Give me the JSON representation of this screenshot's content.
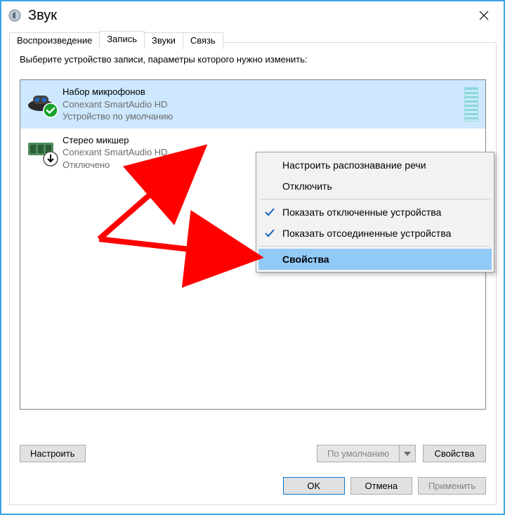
{
  "window": {
    "title": "Звук"
  },
  "tabs": [
    {
      "label": "Воспроизведение",
      "active": false
    },
    {
      "label": "Запись",
      "active": true
    },
    {
      "label": "Звуки",
      "active": false
    },
    {
      "label": "Связь",
      "active": false
    }
  ],
  "instruction": "Выберите устройство записи, параметры которого нужно изменить:",
  "devices": [
    {
      "name": "Набор микрофонов",
      "driver": "Conexant SmartAudio HD",
      "status": "Устройство по умолчанию",
      "selected": true,
      "badge": "check"
    },
    {
      "name": "Стерео микшер",
      "driver": "Conexant SmartAudio HD",
      "status": "Отключено",
      "selected": false,
      "badge": "down"
    }
  ],
  "buttons": {
    "configure": "Настроить",
    "default": "По умолчанию",
    "properties": "Свойства",
    "ok": "OK",
    "cancel": "Отмена",
    "apply": "Применить"
  },
  "context_menu": {
    "items": [
      {
        "label": "Настроить распознавание речи",
        "checked": false,
        "selected": false
      },
      {
        "label": "Отключить",
        "checked": false,
        "selected": false
      },
      {
        "sep": true
      },
      {
        "label": "Показать отключенные устройства",
        "checked": true,
        "selected": false
      },
      {
        "label": "Показать отсоединенные устройства",
        "checked": true,
        "selected": false
      },
      {
        "sep": true
      },
      {
        "label": "Свойства",
        "checked": false,
        "selected": true
      }
    ]
  }
}
